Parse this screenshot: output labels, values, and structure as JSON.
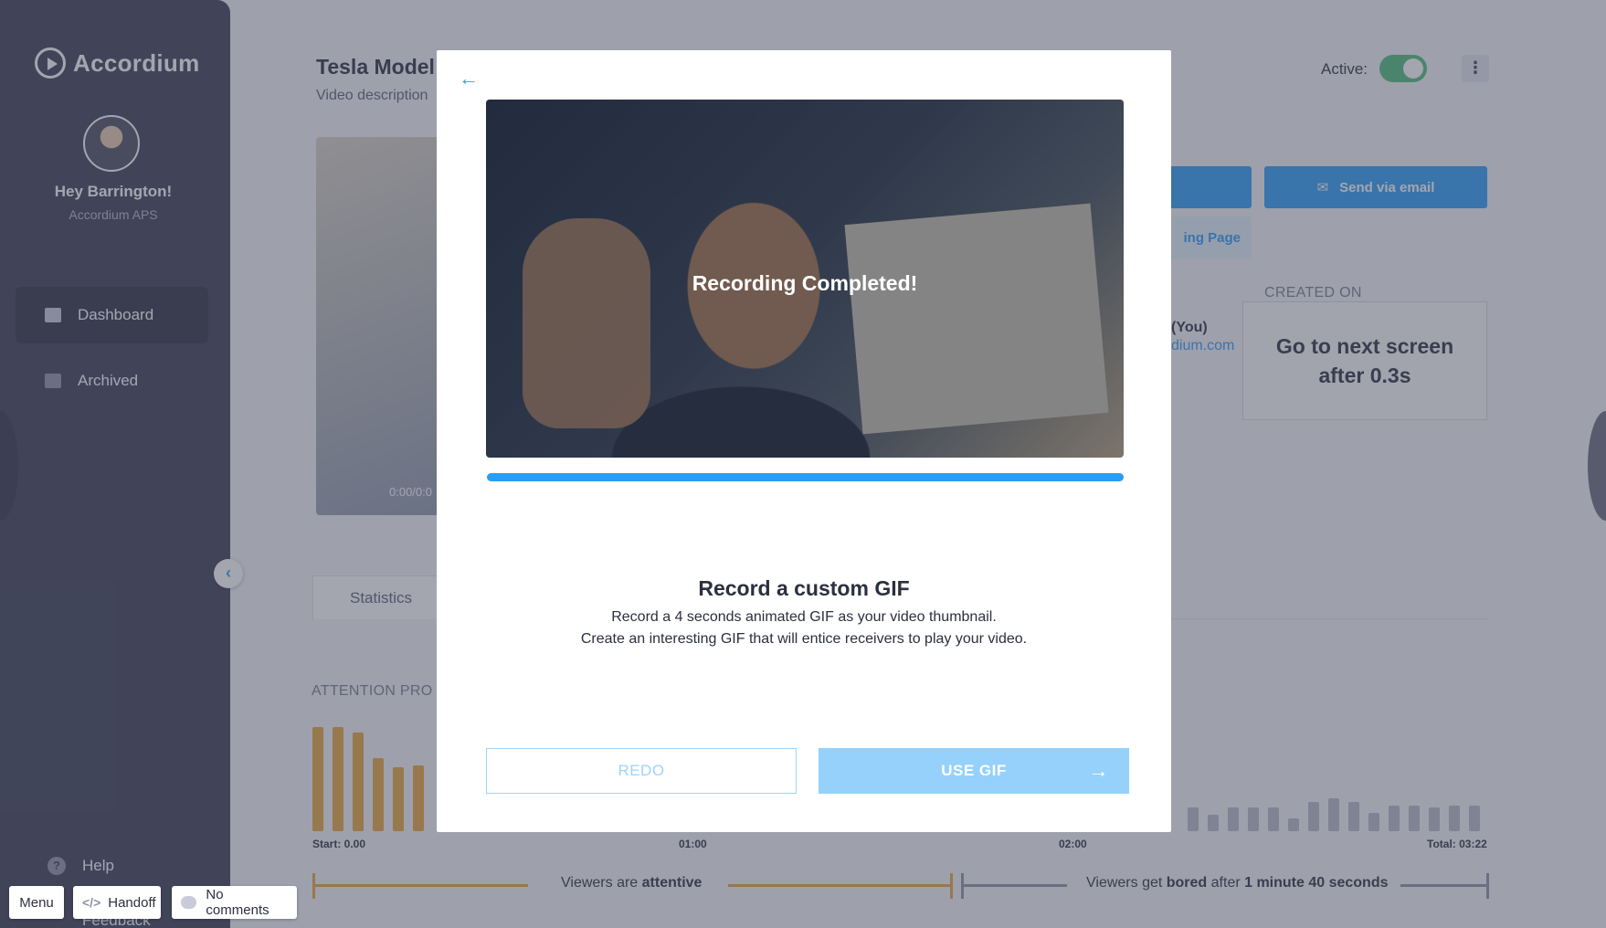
{
  "sidebar": {
    "brand": "Accordium",
    "greeting": "Hey Barrington!",
    "company": "Accordium APS",
    "nav": [
      {
        "label": "Dashboard",
        "active": true
      },
      {
        "label": "Archived",
        "active": false
      }
    ],
    "help_label": "Help",
    "feedback_label": "Feedback",
    "collapse_icon": "chevron-left-icon"
  },
  "main": {
    "title": "Tesla Model",
    "description": "Video description",
    "active_label": "Active:",
    "active_toggle": true,
    "video_time": "0:00/0:0",
    "share_email_label": "Send via email",
    "landing_page_label": "ing Page",
    "created_on_label": "CREATED ON",
    "owner_label": "(You)",
    "owner_email": "dium.com",
    "next_screen_note": "Go to next screen after 0.3s",
    "tabs": [
      "Statistics"
    ],
    "attention_label": "ATTENTION PRO",
    "axis": {
      "start": "Start: 0.00",
      "t1": "01:00",
      "t2": "02:00",
      "total": "Total: 03:22"
    },
    "legend": {
      "attentive_prefix": "Viewers are ",
      "attentive_bold": "attentive",
      "bored_prefix": "Viewers get ",
      "bored_bold": "bored",
      "bored_mid": " after ",
      "bored_time": "1 minute 40 seconds"
    }
  },
  "modal": {
    "back_icon": "arrow-left-icon",
    "video_status": "Recording Completed!",
    "progress": 1.0,
    "title": "Record a custom GIF",
    "line1": "Record a 4 seconds animated GIF as your video thumbnail.",
    "line2": "Create an interesting GIF that will entice receivers to play your video.",
    "redo_label": "REDO",
    "use_label": "USE GIF"
  },
  "toolbar": {
    "menu_label": "Menu",
    "handoff_label": "Handoff",
    "comments_label": "No comments"
  },
  "colors": {
    "accent": "#2a9df4",
    "sidebar": "#3a3d52",
    "bar_attentive": "#e8a43a",
    "bar_bored": "#b7bac8",
    "toggle_on": "#4fbd7a"
  }
}
